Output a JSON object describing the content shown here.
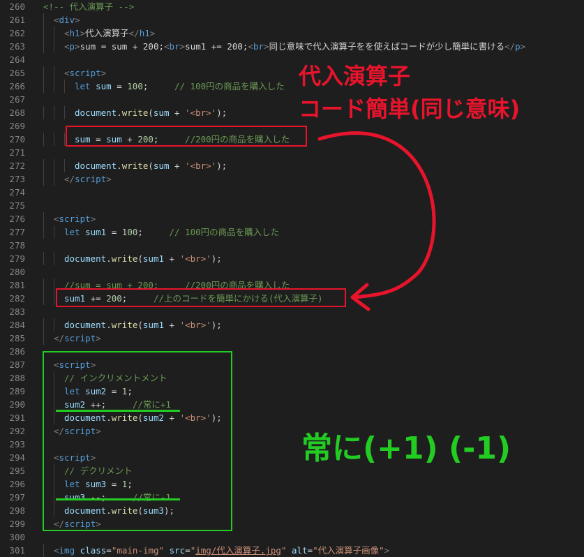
{
  "colors": {
    "background": "#1e1e1e",
    "line_number": "#858585",
    "annotation_red": "#e8142c",
    "annotation_green": "#22cc22"
  },
  "editor": {
    "lines": [
      {
        "num": "260",
        "indent": 0,
        "tokens": [
          {
            "t": "<!-- 代入演算子 -->",
            "c": "t-cmt"
          }
        ]
      },
      {
        "num": "261",
        "indent": 1,
        "tokens": [
          {
            "t": "<",
            "c": "t-tag"
          },
          {
            "t": "div",
            "c": "t-name"
          },
          {
            "t": ">",
            "c": "t-tag"
          }
        ]
      },
      {
        "num": "262",
        "indent": 2,
        "tokens": [
          {
            "t": "<",
            "c": "t-tag"
          },
          {
            "t": "h1",
            "c": "t-name"
          },
          {
            "t": ">",
            "c": "t-tag"
          },
          {
            "t": "代入演算子",
            "c": "t-plain"
          },
          {
            "t": "</",
            "c": "t-tag"
          },
          {
            "t": "h1",
            "c": "t-name"
          },
          {
            "t": ">",
            "c": "t-tag"
          }
        ]
      },
      {
        "num": "263",
        "indent": 2,
        "tokens": [
          {
            "t": "<",
            "c": "t-tag"
          },
          {
            "t": "p",
            "c": "t-name"
          },
          {
            "t": ">",
            "c": "t-tag"
          },
          {
            "t": "sum = sum + 200;",
            "c": "t-plain"
          },
          {
            "t": "<",
            "c": "t-tag"
          },
          {
            "t": "br",
            "c": "t-name"
          },
          {
            "t": ">",
            "c": "t-tag"
          },
          {
            "t": "sum1 += 200;",
            "c": "t-plain"
          },
          {
            "t": "<",
            "c": "t-tag"
          },
          {
            "t": "br",
            "c": "t-name"
          },
          {
            "t": ">",
            "c": "t-tag"
          },
          {
            "t": "同じ意味で代入演算子をを使えばコードが少し簡単に書ける",
            "c": "t-plain"
          },
          {
            "t": "</",
            "c": "t-tag"
          },
          {
            "t": "p",
            "c": "t-name"
          },
          {
            "t": ">",
            "c": "t-tag"
          }
        ]
      },
      {
        "num": "264",
        "indent": 0,
        "tokens": []
      },
      {
        "num": "265",
        "indent": 2,
        "tokens": [
          {
            "t": "<",
            "c": "t-tag"
          },
          {
            "t": "script",
            "c": "t-name"
          },
          {
            "t": ">",
            "c": "t-tag"
          }
        ]
      },
      {
        "num": "266",
        "indent": 3,
        "tokens": [
          {
            "t": "let",
            "c": "t-kw"
          },
          {
            "t": " ",
            "c": "t-plain"
          },
          {
            "t": "sum",
            "c": "t-var"
          },
          {
            "t": " = ",
            "c": "t-plain"
          },
          {
            "t": "100",
            "c": "t-num"
          },
          {
            "t": ";     ",
            "c": "t-plain"
          },
          {
            "t": "// 100円の商品を購入した",
            "c": "t-cmt"
          }
        ]
      },
      {
        "num": "267",
        "indent": 0,
        "tokens": []
      },
      {
        "num": "268",
        "indent": 3,
        "tokens": [
          {
            "t": "document",
            "c": "t-var"
          },
          {
            "t": ".",
            "c": "t-plain"
          },
          {
            "t": "write",
            "c": "t-fn"
          },
          {
            "t": "(",
            "c": "t-plain"
          },
          {
            "t": "sum",
            "c": "t-var"
          },
          {
            "t": " + ",
            "c": "t-plain"
          },
          {
            "t": "'<br>'",
            "c": "t-str"
          },
          {
            "t": ");",
            "c": "t-plain"
          }
        ]
      },
      {
        "num": "269",
        "indent": 0,
        "tokens": []
      },
      {
        "num": "270",
        "indent": 3,
        "tokens": [
          {
            "t": "sum",
            "c": "t-var"
          },
          {
            "t": " = ",
            "c": "t-plain"
          },
          {
            "t": "sum",
            "c": "t-var"
          },
          {
            "t": " + ",
            "c": "t-plain"
          },
          {
            "t": "200",
            "c": "t-num"
          },
          {
            "t": ";     ",
            "c": "t-plain"
          },
          {
            "t": "//200円の商品を購入した",
            "c": "t-cmt"
          }
        ]
      },
      {
        "num": "271",
        "indent": 0,
        "tokens": []
      },
      {
        "num": "272",
        "indent": 3,
        "tokens": [
          {
            "t": "document",
            "c": "t-var"
          },
          {
            "t": ".",
            "c": "t-plain"
          },
          {
            "t": "write",
            "c": "t-fn"
          },
          {
            "t": "(",
            "c": "t-plain"
          },
          {
            "t": "sum",
            "c": "t-var"
          },
          {
            "t": " + ",
            "c": "t-plain"
          },
          {
            "t": "'<br>'",
            "c": "t-str"
          },
          {
            "t": ");",
            "c": "t-plain"
          }
        ]
      },
      {
        "num": "273",
        "indent": 2,
        "tokens": [
          {
            "t": "</",
            "c": "t-tag"
          },
          {
            "t": "script",
            "c": "t-name"
          },
          {
            "t": ">",
            "c": "t-tag"
          }
        ]
      },
      {
        "num": "274",
        "indent": 0,
        "tokens": []
      },
      {
        "num": "275",
        "indent": 0,
        "tokens": []
      },
      {
        "num": "276",
        "indent": 1,
        "tokens": [
          {
            "t": "<",
            "c": "t-tag"
          },
          {
            "t": "script",
            "c": "t-name"
          },
          {
            "t": ">",
            "c": "t-tag"
          }
        ]
      },
      {
        "num": "277",
        "indent": 2,
        "tokens": [
          {
            "t": "let",
            "c": "t-kw"
          },
          {
            "t": " ",
            "c": "t-plain"
          },
          {
            "t": "sum1",
            "c": "t-var"
          },
          {
            "t": " = ",
            "c": "t-plain"
          },
          {
            "t": "100",
            "c": "t-num"
          },
          {
            "t": ";     ",
            "c": "t-plain"
          },
          {
            "t": "// 100円の商品を購入した",
            "c": "t-cmt"
          }
        ]
      },
      {
        "num": "278",
        "indent": 0,
        "tokens": []
      },
      {
        "num": "279",
        "indent": 2,
        "tokens": [
          {
            "t": "document",
            "c": "t-var"
          },
          {
            "t": ".",
            "c": "t-plain"
          },
          {
            "t": "write",
            "c": "t-fn"
          },
          {
            "t": "(",
            "c": "t-plain"
          },
          {
            "t": "sum1",
            "c": "t-var"
          },
          {
            "t": " + ",
            "c": "t-plain"
          },
          {
            "t": "'<br>'",
            "c": "t-str"
          },
          {
            "t": ");",
            "c": "t-plain"
          }
        ]
      },
      {
        "num": "280",
        "indent": 0,
        "tokens": []
      },
      {
        "num": "281",
        "indent": 2,
        "tokens": [
          {
            "t": "//sum = sum + 200;     //200円の商品を購入した",
            "c": "t-cmt"
          }
        ]
      },
      {
        "num": "282",
        "indent": 2,
        "tokens": [
          {
            "t": "sum1",
            "c": "t-var"
          },
          {
            "t": " += ",
            "c": "t-plain"
          },
          {
            "t": "200",
            "c": "t-num"
          },
          {
            "t": ";     ",
            "c": "t-plain"
          },
          {
            "t": "//上のコードを簡単にかける(代入演算子)",
            "c": "t-cmt"
          }
        ]
      },
      {
        "num": "283",
        "indent": 0,
        "tokens": []
      },
      {
        "num": "284",
        "indent": 2,
        "tokens": [
          {
            "t": "document",
            "c": "t-var"
          },
          {
            "t": ".",
            "c": "t-plain"
          },
          {
            "t": "write",
            "c": "t-fn"
          },
          {
            "t": "(",
            "c": "t-plain"
          },
          {
            "t": "sum1",
            "c": "t-var"
          },
          {
            "t": " + ",
            "c": "t-plain"
          },
          {
            "t": "'<br>'",
            "c": "t-str"
          },
          {
            "t": ");",
            "c": "t-plain"
          }
        ]
      },
      {
        "num": "285",
        "indent": 1,
        "tokens": [
          {
            "t": "</",
            "c": "t-tag"
          },
          {
            "t": "script",
            "c": "t-name"
          },
          {
            "t": ">",
            "c": "t-tag"
          }
        ]
      },
      {
        "num": "286",
        "indent": 0,
        "tokens": []
      },
      {
        "num": "287",
        "indent": 1,
        "tokens": [
          {
            "t": "<",
            "c": "t-tag"
          },
          {
            "t": "script",
            "c": "t-name"
          },
          {
            "t": ">",
            "c": "t-tag"
          }
        ]
      },
      {
        "num": "288",
        "indent": 2,
        "tokens": [
          {
            "t": "// インクリメントメント",
            "c": "t-cmt"
          }
        ]
      },
      {
        "num": "289",
        "indent": 2,
        "tokens": [
          {
            "t": "let",
            "c": "t-kw"
          },
          {
            "t": " ",
            "c": "t-plain"
          },
          {
            "t": "sum2",
            "c": "t-var"
          },
          {
            "t": " = ",
            "c": "t-plain"
          },
          {
            "t": "1",
            "c": "t-num"
          },
          {
            "t": ";",
            "c": "t-plain"
          }
        ]
      },
      {
        "num": "290",
        "indent": 2,
        "tokens": [
          {
            "t": "sum2",
            "c": "t-var"
          },
          {
            "t": " ++;     ",
            "c": "t-plain"
          },
          {
            "t": "//常に+1",
            "c": "t-cmt"
          }
        ]
      },
      {
        "num": "291",
        "indent": 2,
        "tokens": [
          {
            "t": "document",
            "c": "t-var"
          },
          {
            "t": ".",
            "c": "t-plain"
          },
          {
            "t": "write",
            "c": "t-fn"
          },
          {
            "t": "(",
            "c": "t-plain"
          },
          {
            "t": "sum2",
            "c": "t-var"
          },
          {
            "t": " + ",
            "c": "t-plain"
          },
          {
            "t": "'<br>'",
            "c": "t-str"
          },
          {
            "t": ");",
            "c": "t-plain"
          }
        ]
      },
      {
        "num": "292",
        "indent": 1,
        "tokens": [
          {
            "t": "</",
            "c": "t-tag"
          },
          {
            "t": "script",
            "c": "t-name"
          },
          {
            "t": ">",
            "c": "t-tag"
          }
        ]
      },
      {
        "num": "293",
        "indent": 0,
        "tokens": []
      },
      {
        "num": "294",
        "indent": 1,
        "tokens": [
          {
            "t": "<",
            "c": "t-tag"
          },
          {
            "t": "script",
            "c": "t-name"
          },
          {
            "t": ">",
            "c": "t-tag"
          }
        ]
      },
      {
        "num": "295",
        "indent": 2,
        "tokens": [
          {
            "t": "// デクリメント",
            "c": "t-cmt"
          }
        ]
      },
      {
        "num": "296",
        "indent": 2,
        "tokens": [
          {
            "t": "let",
            "c": "t-kw"
          },
          {
            "t": " ",
            "c": "t-plain"
          },
          {
            "t": "sum3",
            "c": "t-var"
          },
          {
            "t": " = ",
            "c": "t-plain"
          },
          {
            "t": "1",
            "c": "t-num"
          },
          {
            "t": ";",
            "c": "t-plain"
          }
        ]
      },
      {
        "num": "297",
        "indent": 2,
        "tokens": [
          {
            "t": "sum3",
            "c": "t-var"
          },
          {
            "t": " --;     ",
            "c": "t-plain"
          },
          {
            "t": "//常に-1",
            "c": "t-cmt"
          }
        ]
      },
      {
        "num": "298",
        "indent": 2,
        "tokens": [
          {
            "t": "document",
            "c": "t-var"
          },
          {
            "t": ".",
            "c": "t-plain"
          },
          {
            "t": "write",
            "c": "t-fn"
          },
          {
            "t": "(",
            "c": "t-plain"
          },
          {
            "t": "sum3",
            "c": "t-var"
          },
          {
            "t": ");",
            "c": "t-plain"
          }
        ]
      },
      {
        "num": "299",
        "indent": 1,
        "tokens": [
          {
            "t": "</",
            "c": "t-tag"
          },
          {
            "t": "script",
            "c": "t-name"
          },
          {
            "t": ">",
            "c": "t-tag"
          }
        ]
      },
      {
        "num": "300",
        "indent": 0,
        "tokens": []
      },
      {
        "num": "301",
        "indent": 1,
        "tokens": [
          {
            "t": "<",
            "c": "t-tag"
          },
          {
            "t": "img",
            "c": "t-name"
          },
          {
            "t": " ",
            "c": "t-plain"
          },
          {
            "t": "class",
            "c": "t-attr"
          },
          {
            "t": "=",
            "c": "t-plain"
          },
          {
            "t": "\"main-img\"",
            "c": "t-str"
          },
          {
            "t": " ",
            "c": "t-plain"
          },
          {
            "t": "src",
            "c": "t-attr"
          },
          {
            "t": "=",
            "c": "t-plain"
          },
          {
            "t": "\"",
            "c": "t-str"
          },
          {
            "t": "img/代入演算子.jpg",
            "c": "t-link"
          },
          {
            "t": "\"",
            "c": "t-str"
          },
          {
            "t": " ",
            "c": "t-plain"
          },
          {
            "t": "alt",
            "c": "t-attr"
          },
          {
            "t": "=",
            "c": "t-plain"
          },
          {
            "t": "\"代入演算子画像\"",
            "c": "t-str"
          },
          {
            "t": ">",
            "c": "t-tag"
          }
        ]
      }
    ]
  },
  "annotations": {
    "red_title": "代入演算子",
    "red_subtitle": "コード簡単(同じ意味)",
    "green_text": "常に(+1) (-1)"
  }
}
